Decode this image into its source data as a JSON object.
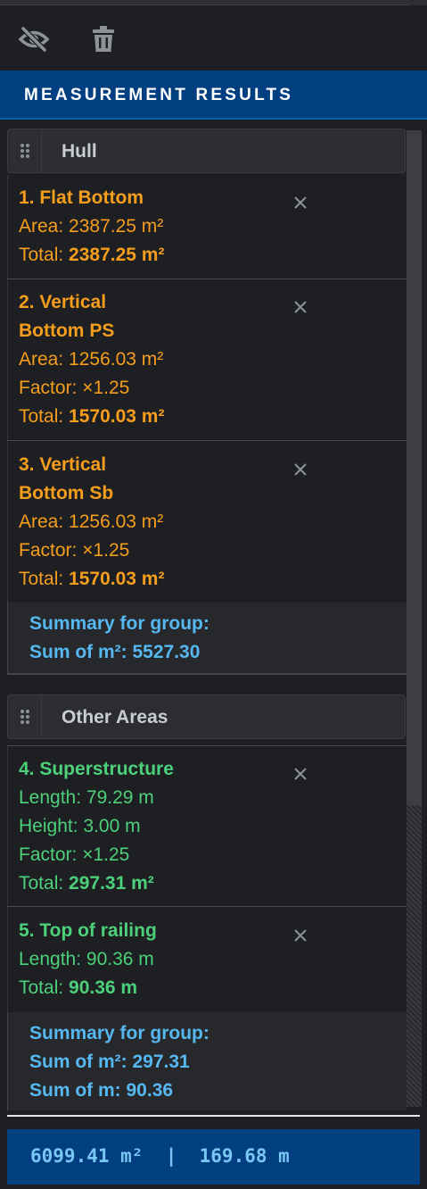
{
  "toolbar": {
    "hide_icon": "eye-slash-icon",
    "delete_icon": "trash-icon"
  },
  "header": {
    "title": "MEASUREMENT RESULTS"
  },
  "groups": [
    {
      "name": "Hull",
      "color": "#f59d1c",
      "items": [
        {
          "title": "1. Flat Bottom",
          "area_label": "Area:",
          "area_value": "2387.25 m²",
          "total_label": "Total:",
          "total_value": "2387.25 m²"
        },
        {
          "title_line1": "2. Vertical",
          "title_line2": "Bottom PS",
          "area_label": "Area:",
          "area_value": "1256.03 m²",
          "factor_label": "Factor:",
          "factor_value": "×1.25",
          "total_label": "Total:",
          "total_value": "1570.03 m²"
        },
        {
          "title_line1": "3. Vertical",
          "title_line2": "Bottom Sb",
          "area_label": "Area:",
          "area_value": "1256.03 m²",
          "factor_label": "Factor:",
          "factor_value": "×1.25",
          "total_label": "Total:",
          "total_value": "1570.03 m²"
        }
      ],
      "summary": {
        "heading": "Summary for group:",
        "sum_area": "Sum of m²: 5527.30"
      }
    },
    {
      "name": "Other Areas",
      "color": "#4cd07a",
      "items": [
        {
          "title": "4. Superstructure",
          "length_label": "Length:",
          "length_value": "79.29 m",
          "height_label": "Height:",
          "height_value": "3.00 m",
          "factor_label": "Factor:",
          "factor_value": "×1.25",
          "total_label": "Total:",
          "total_value": "297.31 m²"
        },
        {
          "title": "5. Top of railing",
          "length_label": "Length:",
          "length_value": "90.36 m",
          "total_label": "Total:",
          "total_value": "90.36 m"
        }
      ],
      "summary": {
        "heading": "Summary for group:",
        "sum_area": "Sum of m²: 297.31",
        "sum_length": "Sum of m: 90.36"
      }
    }
  ],
  "footer": {
    "totals": "6099.41 m²  |  169.68 m"
  },
  "colors": {
    "accent_blue": "#023f80",
    "summary_blue": "#56b8f0",
    "hull": "#f59d1c",
    "other": "#4cd07a"
  }
}
